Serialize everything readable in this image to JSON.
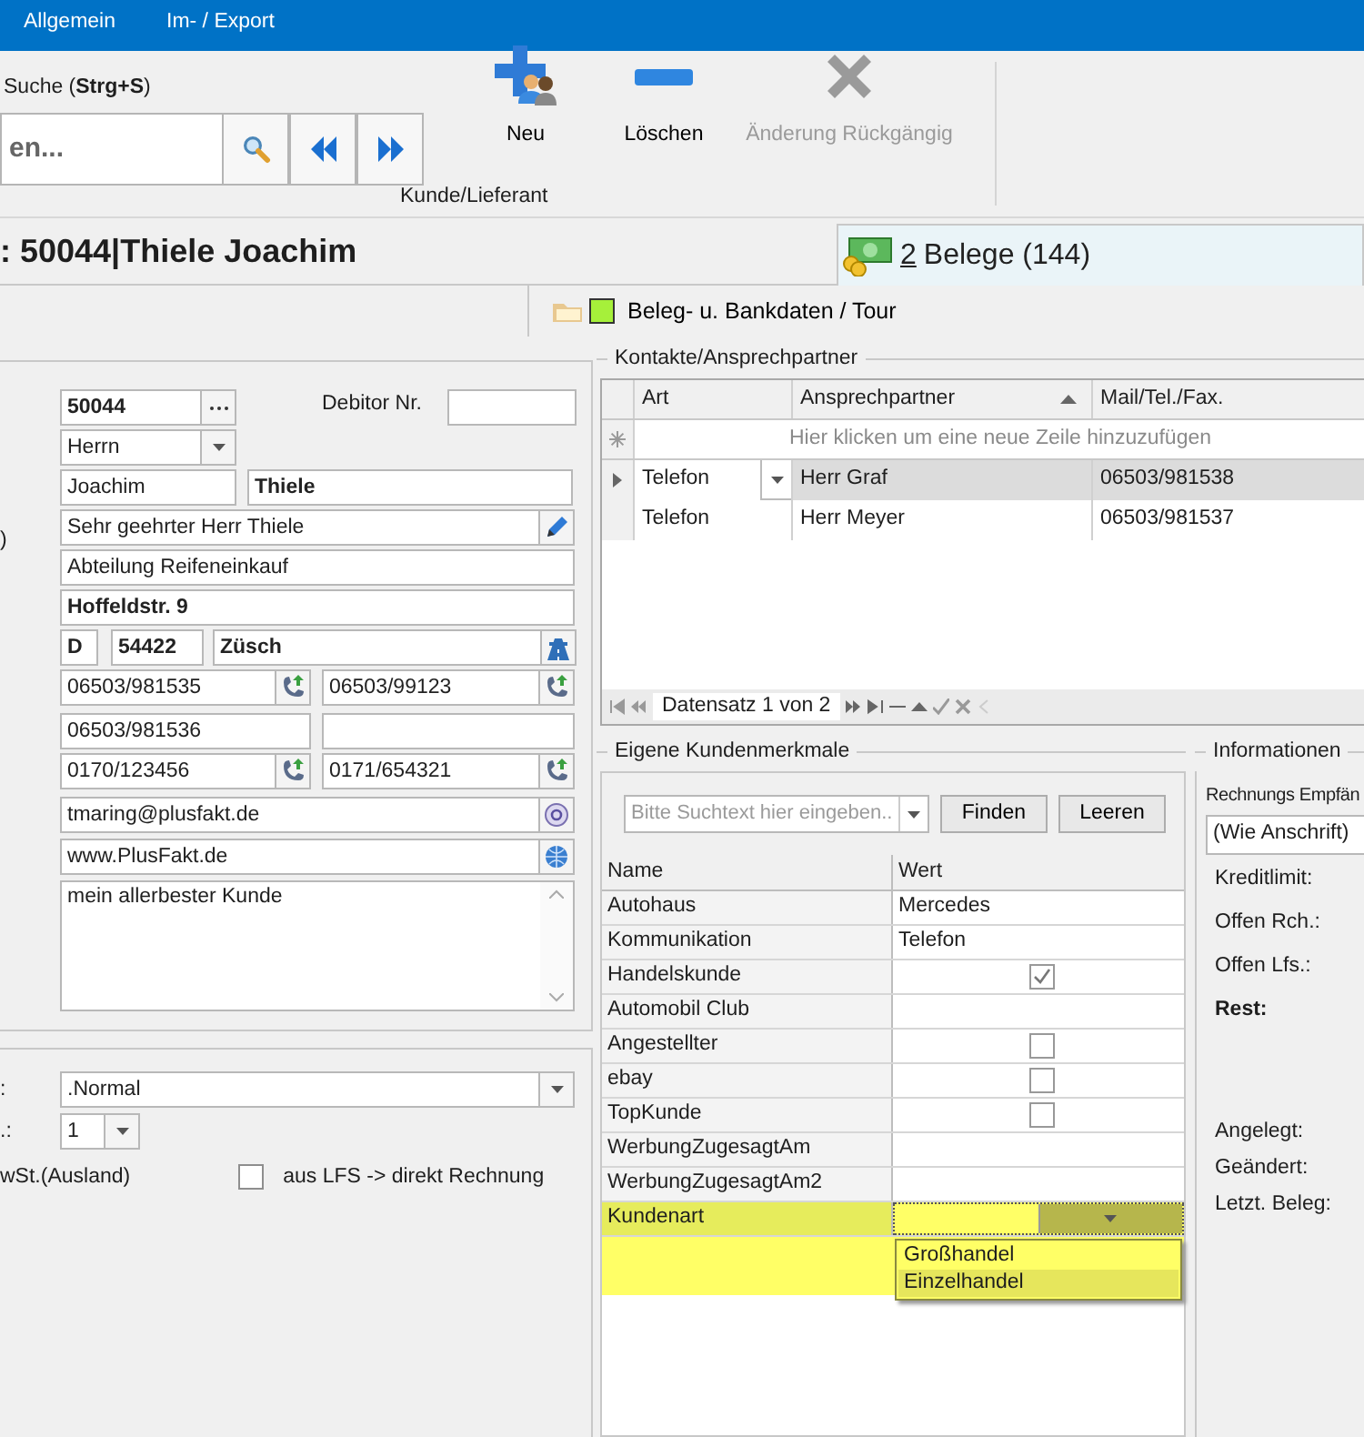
{
  "ribbon_tabs": [
    "Allgemein",
    "Im- / Export"
  ],
  "search": {
    "label": "Suche (**Strg+S**)",
    "placeholder": "en..."
  },
  "ribbon_group": "Kunde/Lieferant",
  "actions": [
    {
      "kind": "add",
      "label": "Neu",
      "disabled": false
    },
    {
      "kind": "delete",
      "label": "Löschen",
      "disabled": false
    },
    {
      "kind": "undo",
      "label": "Änderung Rückgängig",
      "disabled": true
    }
  ],
  "title": ": 50044|Thiele Joachim",
  "documents_tab": {
    "accelerator": "2",
    "label": "Belege (144)"
  },
  "sub_tab": {
    "label": "Beleg- u. Bankdaten / Tour"
  },
  "customer": {
    "number": "50044",
    "debitor_label": "Debitor Nr.",
    "salutation": "Herrn",
    "first_name": "Joachim",
    "last_name": "Thiele",
    "letter_salutation": "Sehr geehrter Herr Thiele",
    "cut_label": ")",
    "department": "Abteilung Reifeneinkauf",
    "street": "Hoffeldstr. 9",
    "country": "D",
    "zip": "54422",
    "city": "Züsch",
    "phone_1": "06503/981535",
    "phone_2": "06503/99123",
    "fax": "06503/981536",
    "mobile_1": "0170/123456",
    "mobile_2": "0171/654321",
    "email": "tmaring@plusfakt.de",
    "website": "www.PlusFakt.de",
    "note": "mein allerbester Kunde"
  },
  "settings": {
    "label_1": ":",
    "combo_1": ".Normal",
    "label_2": ".:",
    "combo_2": "1",
    "label_3": "wSt.(Ausland)",
    "direct_invoice": {
      "label": "aus LFS -> direkt Rechnung",
      "checked": false
    }
  },
  "contacts": {
    "title": "Kontakte/Ansprechpartner",
    "columns": [
      {
        "label": "Art",
        "sorted": false
      },
      {
        "label": "Ansprechpartner",
        "sorted": true
      },
      {
        "label": "Mail/Tel./Fax.",
        "sorted": false
      }
    ],
    "new_row_hint": "Hier klicken um eine neue Zeile hinzuzufügen",
    "rows": [
      {
        "cells": [
          "Telefon",
          "Herr Graf",
          "06503/981538"
        ],
        "selected": true
      },
      {
        "cells": [
          "Telefon",
          "Herr Meyer",
          "06503/981537"
        ],
        "selected": false
      }
    ],
    "navigator": "Datensatz 1 von 2"
  },
  "features": {
    "title": "Eigene Kundenmerkmale",
    "search_placeholder": "Bitte Suchtext hier eingeben..",
    "buttons": [
      "Finden",
      "Leeren"
    ],
    "columns": [
      "Name",
      "Wert"
    ],
    "rows": [
      {
        "name": "Autohaus",
        "kind": "text",
        "value": "Mercedes",
        "selected": false
      },
      {
        "name": "Kommunikation",
        "kind": "text",
        "value": "Telefon",
        "selected": false
      },
      {
        "name": "Handelskunde",
        "kind": "check",
        "checked": true,
        "selected": false
      },
      {
        "name": "Automobil Club",
        "kind": "text",
        "selected": false
      },
      {
        "name": "Angestellter",
        "kind": "check",
        "checked": false,
        "selected": false
      },
      {
        "name": "ebay",
        "kind": "check",
        "checked": false,
        "selected": false
      },
      {
        "name": "TopKunde",
        "kind": "check",
        "checked": false,
        "selected": false
      },
      {
        "name": "WerbungZugesagtAm",
        "kind": "text",
        "selected": false
      },
      {
        "name": "WerbungZugesagtAm2",
        "kind": "text",
        "selected": false
      },
      {
        "name": "Kundenart",
        "kind": "combo",
        "selected": true
      }
    ],
    "dropdown": [
      {
        "label": "Großhandel",
        "selected": false
      },
      {
        "label": "Einzelhandel",
        "selected": true
      }
    ]
  },
  "info": {
    "title": "Informationen",
    "recipient_label": "Rechnungs Empfän",
    "recipient": "(Wie Anschrift)",
    "amounts": [
      {
        "label": "Kreditlimit:",
        "kind": "normal"
      },
      {
        "label": "Offen Rch.:",
        "kind": "normal"
      },
      {
        "label": "Offen Lfs.:",
        "kind": "normal"
      },
      {
        "label": "Rest:",
        "kind": "total"
      }
    ],
    "dates": [
      "Angelegt:",
      "Geändert:",
      "Letzt. Beleg:"
    ]
  }
}
